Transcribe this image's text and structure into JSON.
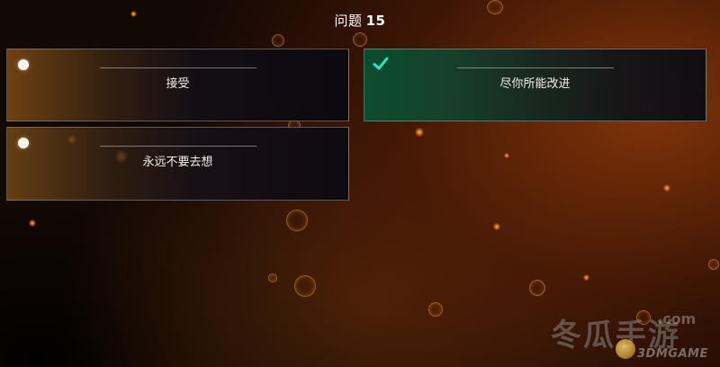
{
  "header": {
    "prefix": "问题",
    "number": "15"
  },
  "options": [
    {
      "label": "接受",
      "state": "radio-unselected"
    },
    {
      "label": "尽你所能改进",
      "state": "checked"
    },
    {
      "label": "永远不要去想",
      "state": "radio-unselected"
    }
  ],
  "watermark": {
    "cn": "冬瓜手游",
    "com": ".com",
    "en": "3DMGAME"
  },
  "colors": {
    "selected_accent": "#2ee0c4",
    "selected_bg": "#0a5032",
    "option_border": "#96969f",
    "glow": "#e0862a"
  },
  "icons": {
    "unselected": "radio-dot-icon",
    "selected": "checkmark-icon"
  }
}
